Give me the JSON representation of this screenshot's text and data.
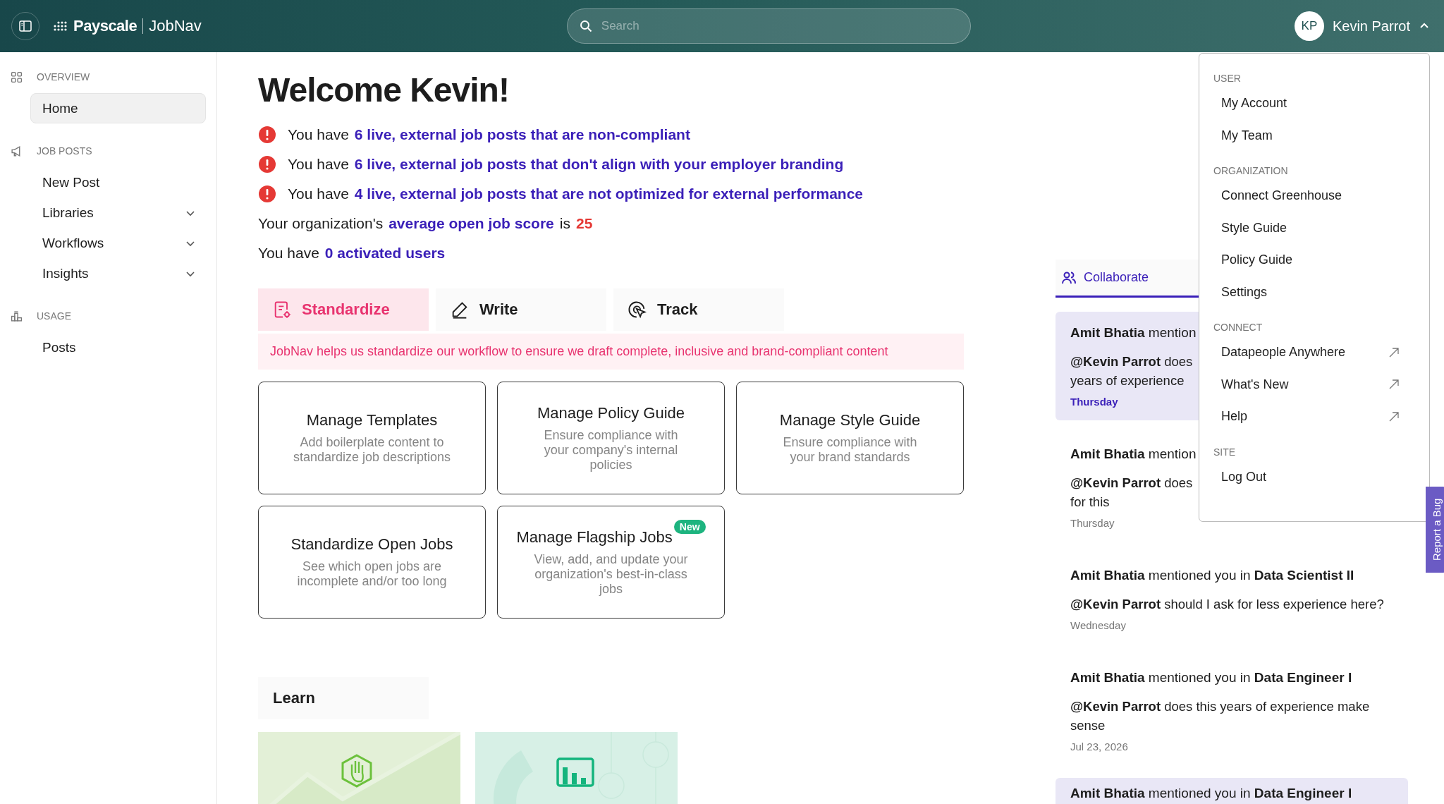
{
  "header": {
    "brand": "Payscale",
    "product": "JobNav",
    "search": {
      "placeholder": "Search"
    },
    "user": {
      "initials": "KP",
      "name": "Kevin Parrot",
      "menu_open": true
    }
  },
  "sidebar": {
    "sections": [
      {
        "label": "OVERVIEW",
        "items": [
          {
            "label": "Home",
            "selected": true,
            "expandable": false
          }
        ]
      },
      {
        "label": "JOB POSTS",
        "items": [
          {
            "label": "New Post",
            "selected": false,
            "expandable": false
          },
          {
            "label": "Libraries",
            "selected": false,
            "expandable": true
          },
          {
            "label": "Workflows",
            "selected": false,
            "expandable": true
          },
          {
            "label": "Insights",
            "selected": false,
            "expandable": true
          }
        ]
      },
      {
        "label": "USAGE",
        "items": [
          {
            "label": "Posts",
            "selected": false,
            "expandable": false
          }
        ]
      }
    ]
  },
  "welcome": {
    "title": "Welcome Kevin!",
    "alerts": [
      {
        "prefix": "You have",
        "link": "6 live, external job posts that are non-compliant"
      },
      {
        "prefix": "You have",
        "link": "6 live, external job posts that don't align with your employer branding"
      },
      {
        "prefix": "You have",
        "link": "4 live, external job posts that are not optimized for external performance"
      }
    ],
    "score": {
      "prefix": "Your organization's",
      "link": "average open job score",
      "middle": "is",
      "value": "25"
    },
    "users": {
      "prefix": "You have",
      "link": "0 activated users"
    }
  },
  "tabs": [
    {
      "label": "Standardize",
      "selected": true
    },
    {
      "label": "Write",
      "selected": false
    },
    {
      "label": "Track",
      "selected": false
    }
  ],
  "banner": "JobNav helps us standardize our workflow to ensure we draft complete, inclusive and brand-compliant content",
  "cards": [
    {
      "title": "Manage Templates",
      "description": "Add boilerplate content to standardize job descriptions"
    },
    {
      "title": "Manage Policy Guide",
      "description": "Ensure compliance with your company's internal policies"
    },
    {
      "title": "Manage Style Guide",
      "description": "Ensure compliance with your brand standards"
    },
    {
      "title": "Standardize Open Jobs",
      "description": "See which open jobs are incomplete and/or too long"
    },
    {
      "title": "Manage Flagship Jobs",
      "description": "View, add, and update your organization's best-in-class jobs",
      "badge": "New"
    }
  ],
  "learn": {
    "title": "Learn"
  },
  "activity": {
    "tab": "Collaborate",
    "items": [
      {
        "header": "**Amit Bhatia** mention",
        "body": [
          "**@Kevin Parrot** does",
          "years of experience"
        ],
        "time": "Thursday",
        "unread": true
      },
      {
        "header": "**Amit Bhatia** mention",
        "body": [
          "**@Kevin Parrot** does",
          "for this"
        ],
        "time": "Thursday",
        "unread": false
      },
      {
        "header": "**Amit Bhatia** mentioned you in **Data Scientist II**",
        "body": [
          "**@Kevin Parrot** should I ask for less experience here?"
        ],
        "time": "Wednesday",
        "unread": false
      },
      {
        "header": "**Amit Bhatia** mentioned you in **Data Engineer I**",
        "body": [
          "**@Kevin Parrot** does this years of experience make",
          "sense"
        ],
        "time": "Jul 23, 2026",
        "unread": false
      },
      {
        "header": "**Amit Bhatia** mentioned you in **Data Engineer I**",
        "unread": true
      }
    ]
  },
  "user_menu": {
    "sections": [
      {
        "label": "USER",
        "items": [
          {
            "label": "My Account",
            "external": false
          },
          {
            "label": "My Team",
            "external": false
          }
        ]
      },
      {
        "label": "ORGANIZATION",
        "items": [
          {
            "label": "Connect Greenhouse",
            "external": false
          },
          {
            "label": "Style Guide",
            "external": false
          },
          {
            "label": "Policy Guide",
            "external": false
          },
          {
            "label": "Settings",
            "external": false
          }
        ]
      },
      {
        "label": "CONNECT",
        "items": [
          {
            "label": "Datapeople Anywhere",
            "external": true
          },
          {
            "label": "What's New",
            "external": true
          },
          {
            "label": "Help",
            "external": true
          }
        ]
      },
      {
        "label": "SITE",
        "items": [
          {
            "label": "Log Out",
            "external": false
          }
        ]
      }
    ]
  },
  "report_bug": "Report a Bug"
}
